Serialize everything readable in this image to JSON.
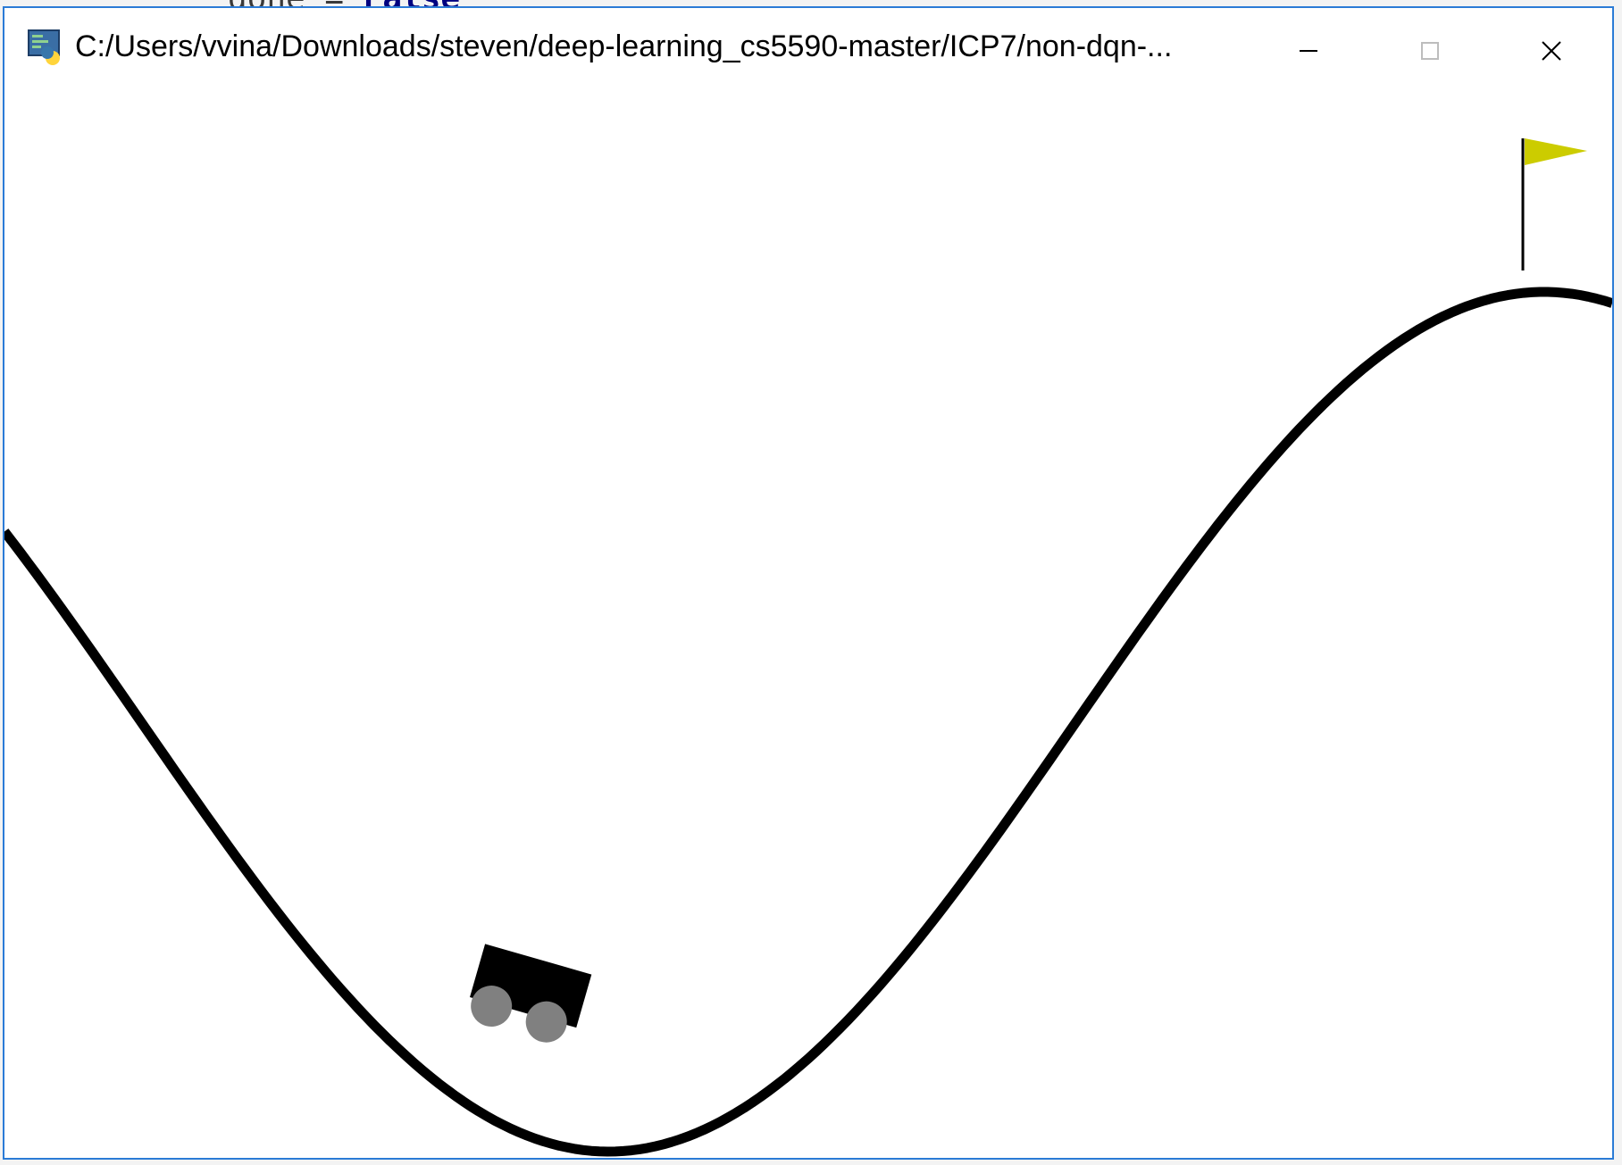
{
  "window": {
    "title": "C:/Users/vvina/Downloads/steven/deep-learning_cs5590-master/ICP7/non-dqn-...",
    "icon": "python-app-icon",
    "controls": [
      "minimize-icon",
      "maximize-icon",
      "close-icon"
    ]
  },
  "backdrop": {
    "code_line_lhs": "done = ",
    "code_line_rhs": "False"
  },
  "scene": {
    "environment": "mountain-car",
    "background_color": "#ffffff",
    "track_color": "#000000",
    "car_body_color": "#000000",
    "car_wheel_color": "#808080",
    "flag_pole_color": "#000000",
    "flag_color": "#cccc00"
  }
}
